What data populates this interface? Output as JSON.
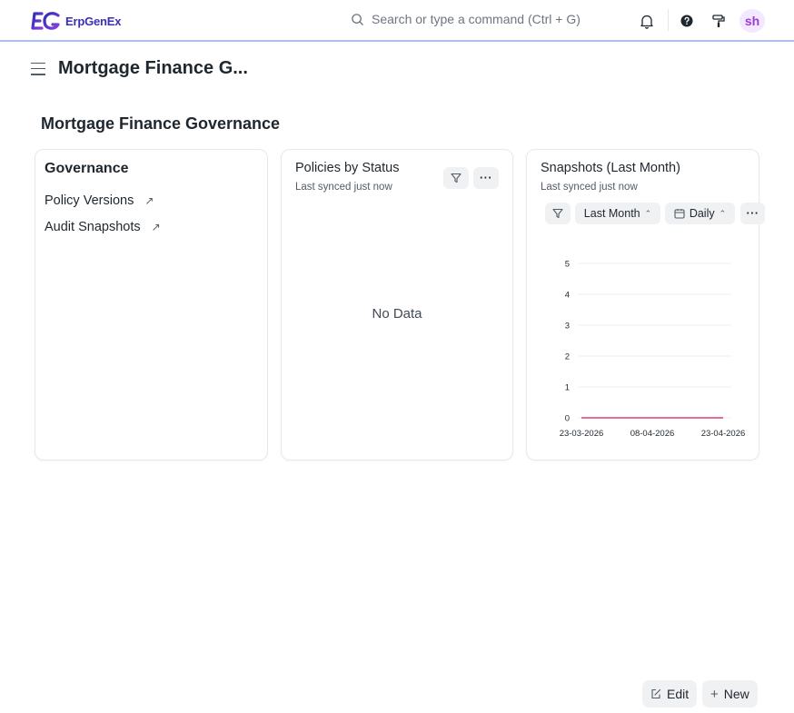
{
  "navbar": {
    "brand": "ErpGenEx",
    "search_placeholder": "Search or type a command (Ctrl + G)",
    "avatar_initials": "sh"
  },
  "page": {
    "title": "Mortgage Finance G...",
    "section_title": "Mortgage Finance Governance"
  },
  "shortcuts_card": {
    "title": "Governance",
    "links": [
      "Policy Versions",
      "Audit Snapshots"
    ]
  },
  "status_card": {
    "title": "Policies by Status",
    "subtitle": "Last synced just now",
    "empty_text": "No Data"
  },
  "snapshots_card": {
    "title": "Snapshots (Last Month)",
    "subtitle": "Last synced just now",
    "timespan_label": "Last Month",
    "interval_label": "Daily"
  },
  "chart_data": {
    "type": "line",
    "x_tick_labels": [
      "23-03-2026",
      "08-04-2026",
      "23-04-2026"
    ],
    "y_ticks": [
      0,
      1,
      2,
      3,
      4,
      5
    ],
    "ylim": [
      0,
      5
    ],
    "series": [
      {
        "values": [
          0,
          0,
          0
        ]
      }
    ],
    "line_color": "#e86c9a",
    "grid": true
  },
  "footer": {
    "edit_label": "Edit",
    "new_label": "New"
  }
}
